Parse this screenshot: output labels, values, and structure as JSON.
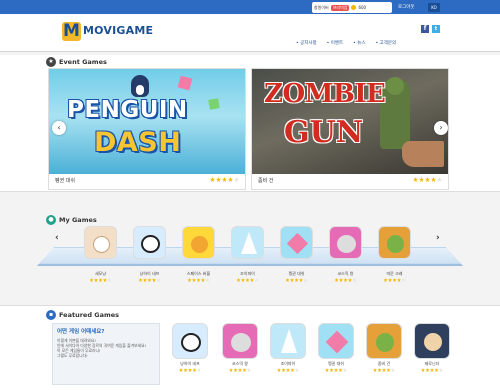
{
  "colors": {
    "topbar": "#2d6bc2",
    "brand": "#1b4f96",
    "logo_bg": "#f3b82a",
    "star": "#f5b800"
  },
  "topbar": {
    "user_name": "창원이버",
    "premium_badge": "프리미엄",
    "coins": "600",
    "logout_label": "로그아웃",
    "lang_label": "KO"
  },
  "header": {
    "logo_letter": "M",
    "logo_text": "MOVIGAME",
    "social": [
      "f",
      "t"
    ],
    "nav": [
      "• 공지사항",
      "• 이벤트",
      "• 뉴스",
      "• 고객문의"
    ]
  },
  "event_section": {
    "title": "Event Games",
    "icon": "star-circle-icon",
    "cards": [
      {
        "name": "펭귄 대쉬",
        "art_line1": "PENGUIN",
        "art_line2": "DASH",
        "rating": 4
      },
      {
        "name": "좀비 건",
        "art_line1": "ZOMBIE",
        "art_line2": "GUN",
        "rating": 4
      }
    ],
    "prev_arrow": "‹",
    "next_arrow": "›"
  },
  "my_games": {
    "title": "My Games",
    "icon": "user-circle-icon",
    "prev_arrow": "‹",
    "next_arrow": "›",
    "games": [
      {
        "name": "세모냥",
        "art": "kitty",
        "rating": 4
      },
      {
        "name": "냥하이 네프",
        "art": "panda",
        "rating": 4
      },
      {
        "name": "스페이스 버블",
        "art": "lion",
        "rating": 4
      },
      {
        "name": "조이파이",
        "art": "triangle",
        "rating": 4
      },
      {
        "name": "펭귄 대쉬",
        "art": "cube",
        "rating": 4
      },
      {
        "name": "코스믹 왕",
        "art": "bear",
        "rating": 4
      },
      {
        "name": "마운 크래",
        "art": "zombie",
        "rating": 4
      }
    ]
  },
  "featured": {
    "title": "Featured Games",
    "icon": "book-circle-icon",
    "notice_question": "어떤 게임 어때세요?",
    "notice_lines": [
      "이렇게 이쁜을 데려와요!",
      "인에 서이다아 다양한 장르의 귀여운 게임을 즐겨보세요!",
      "이 모든 게임들이 무료라니!",
      "그렇도 무료랍니다!"
    ],
    "games": [
      {
        "name": "냥하이 네프",
        "art": "panda",
        "rating": 4
      },
      {
        "name": "코스믹 왕",
        "art": "bear",
        "rating": 4
      },
      {
        "name": "조이파이",
        "art": "triangle",
        "rating": 4
      },
      {
        "name": "펭귄 대쉬",
        "art": "cube",
        "rating": 4
      },
      {
        "name": "좀비 건",
        "art": "zombie",
        "rating": 4
      },
      {
        "name": "제로닌자",
        "art": "black",
        "rating": 4
      }
    ]
  }
}
